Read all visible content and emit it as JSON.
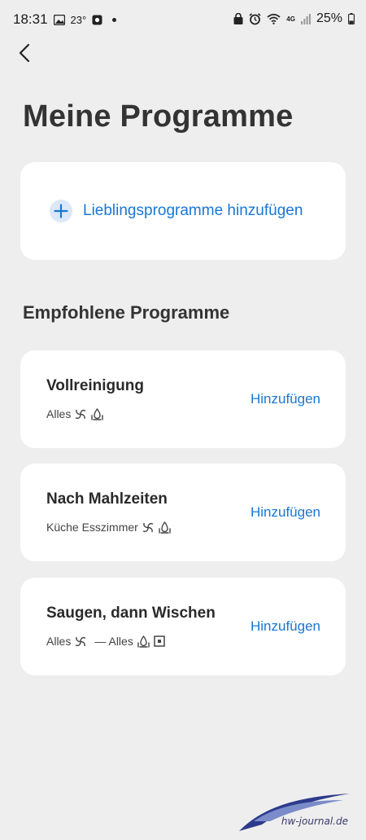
{
  "status_bar": {
    "time": "18:31",
    "temperature": "23°",
    "network": "4G",
    "battery": "25%"
  },
  "header": {
    "title": "Meine Programme"
  },
  "favorites": {
    "add_label": "Lieblingsprogramme hinzufügen"
  },
  "recommended": {
    "title": "Empfohlene Programme",
    "add_label": "Hinzufügen",
    "programs": [
      {
        "name": "Vollreinigung",
        "meta": [
          "Alles"
        ]
      },
      {
        "name": "Nach Mahlzeiten",
        "meta": [
          "Küche Esszimmer"
        ]
      },
      {
        "name": "Saugen, dann Wischen",
        "meta": [
          "Alles",
          "— Alles"
        ]
      }
    ]
  },
  "watermark": {
    "text": "hw-journal.de"
  },
  "colors": {
    "accent": "#1977d4",
    "background": "#eeeeee",
    "card": "#ffffff"
  }
}
